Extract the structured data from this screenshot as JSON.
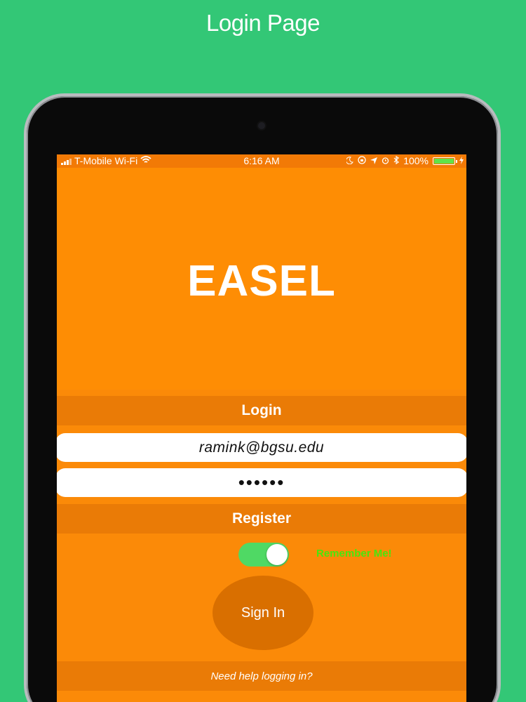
{
  "page_title": "Login Page",
  "status_bar": {
    "carrier": "T-Mobile Wi-Fi",
    "time": "6:16 AM",
    "battery": "100%",
    "battery_level": 1.0,
    "icons": [
      "signal-icon",
      "wifi-icon",
      "moon-icon",
      "lock-rotation-icon",
      "location-arrow-icon",
      "alarm-icon",
      "bluetooth-icon",
      "battery-icon",
      "charging-icon"
    ]
  },
  "app": {
    "name": "EASEL"
  },
  "form": {
    "login_label": "Login",
    "email_value": "ramink@bgsu.edu",
    "password_value": "••••••",
    "register_label": "Register",
    "remember_me_label": "Remember Me!",
    "remember_me_on": true,
    "sign_in_label": "Sign In",
    "help_link": "Need help logging in?"
  },
  "colors": {
    "background": "#33c776",
    "screen": "#fe8d04",
    "bar": "#ea7b06",
    "button": "#d96f00",
    "toggle_on": "#4fd964",
    "remember_text": "#49e60d"
  }
}
